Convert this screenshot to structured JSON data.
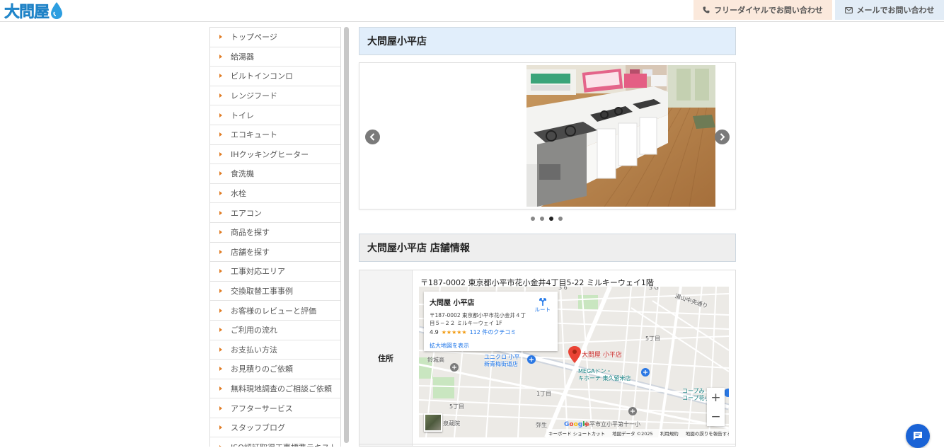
{
  "header": {
    "logo_text": "大問屋",
    "tel_button": "フリーダイヤルでお問い合わせ",
    "mail_button": "メールでお問い合わせ"
  },
  "sidebar": {
    "items": [
      {
        "label": "トップページ"
      },
      {
        "label": "給湯器"
      },
      {
        "label": "ビルトインコンロ"
      },
      {
        "label": "レンジフード"
      },
      {
        "label": "トイレ"
      },
      {
        "label": "エコキュート"
      },
      {
        "label": "IHクッキングヒーター"
      },
      {
        "label": "食洗機"
      },
      {
        "label": "水栓"
      },
      {
        "label": "エアコン"
      },
      {
        "label": "商品を探す"
      },
      {
        "label": "店舗を探す"
      },
      {
        "label": "工事対応エリア"
      },
      {
        "label": "交換取替工事事例"
      },
      {
        "label": "お客様のレビューと評価"
      },
      {
        "label": "ご利用の流れ"
      },
      {
        "label": "お支払い方法"
      },
      {
        "label": "お見積りのご依頼"
      },
      {
        "label": "無料現地調査のご相談ご依頼"
      },
      {
        "label": "アフターサービス"
      },
      {
        "label": "スタッフブログ"
      },
      {
        "label": "ISO認証取得工事標準テキスト"
      }
    ]
  },
  "main": {
    "store_title": "大問屋小平店",
    "slider": {
      "total_slides": 4,
      "active_index": 2
    },
    "info_title": "大問屋小平店 店舗情報",
    "info": {
      "address_label": "住所",
      "address_value": "〒187-0002 東京都小平市花小金井4丁目5-22 ミルキーウェイ1階"
    }
  },
  "map": {
    "card_name": "大問屋 小平店",
    "card_address": "〒187-0002 東京都小平市花小金井４丁目５−２２ ミルキーウェイ 1F",
    "rating": "4.9",
    "stars": "★★★★★",
    "reviews": "112 件のクチコミ",
    "route": "ルート",
    "larger_map": "拡大地図を表示",
    "pin_label": "大問屋 小平店",
    "labels": {
      "uniqlo": "ユニクロ 小平\n新青梅街道店",
      "mega": "MEGAドン・\nキホーテ 東久留米店",
      "coop": "コープみ\nコープ花小金",
      "kinoshita": "鈴城高",
      "chome5a": "5丁目",
      "chome5b": "5丁目",
      "chome1": "1丁目",
      "senzoin": "泉蔵院",
      "yayoi": "弥生",
      "school": "小平市立小平第十一小",
      "lake": "湯山中央通り"
    },
    "footer": {
      "shortcuts": "キーボード ショートカット",
      "data": "地図データ ©2025",
      "terms": "利用規約",
      "report": "地図の誤りを報告する"
    },
    "google": "Google",
    "zoom_in": "+",
    "zoom_out": "−"
  },
  "colors": {
    "accent_orange": "#e07b22",
    "title_blue_bg": "#e1eefb",
    "chat_blue": "#1a63d6",
    "logo_blue": "#2d9ee0"
  },
  "icons": {
    "tel": "phone-icon",
    "mail": "mail-icon",
    "chat": "chat-icon"
  }
}
